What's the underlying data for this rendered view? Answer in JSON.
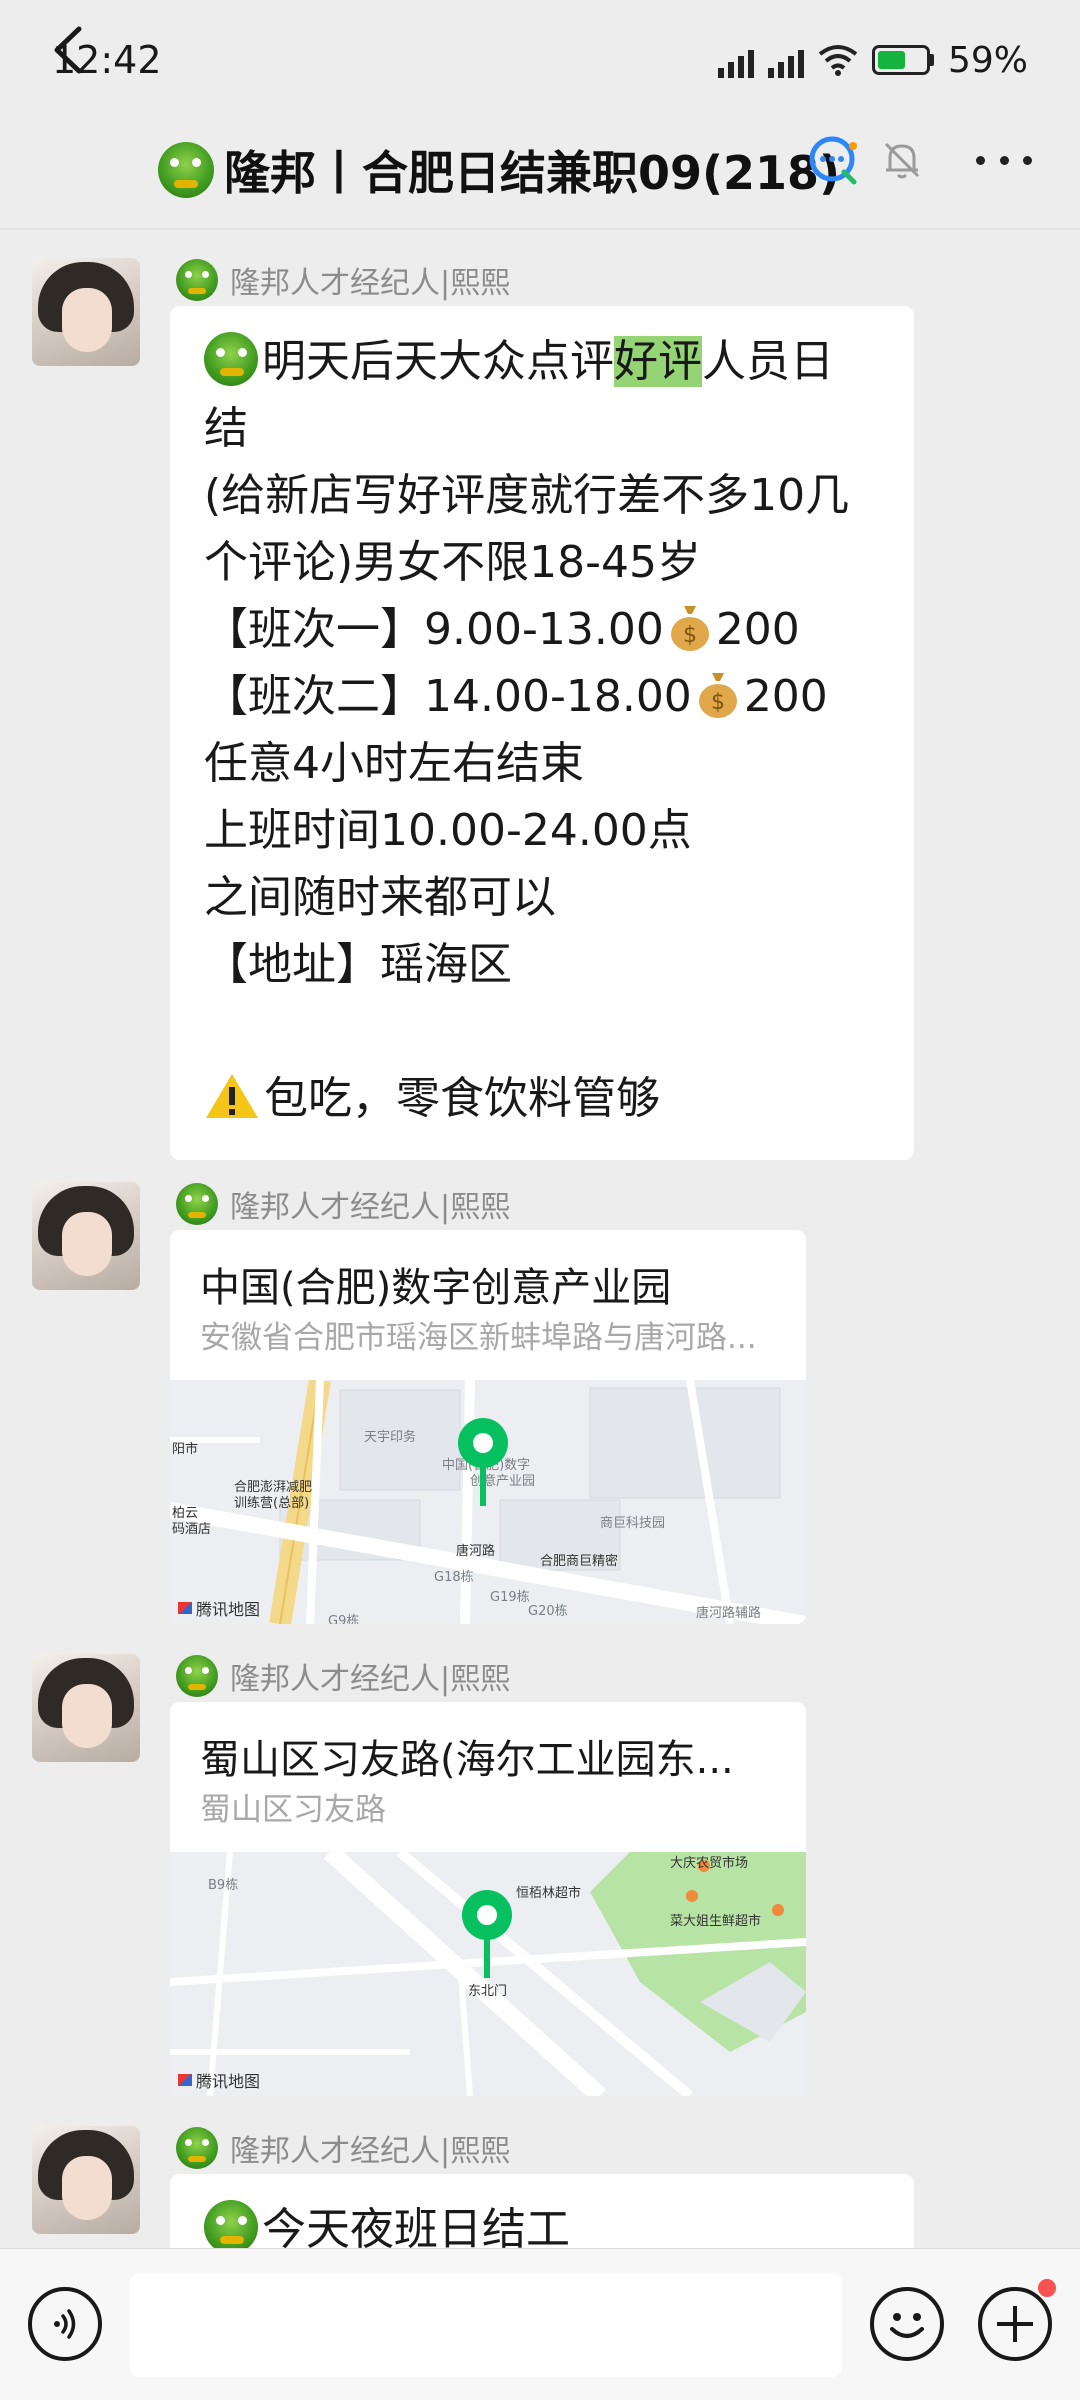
{
  "status_bar": {
    "time": "12:42",
    "battery": "59%"
  },
  "header": {
    "title": "隆邦丨合肥日结兼职09(218)"
  },
  "messages": [
    {
      "sender": "隆邦人才经纪人|熙熙",
      "lines": {
        "l1_pre": "明天后天大众点评",
        "l1_hl": "好评",
        "l1_post": "人员日",
        "l2": "结",
        "l3": "(给新店写好评度就行差不多10几",
        "l4": "个评论)男女不限18-45岁",
        "l5_pre": "【班次一】9.00-13.00",
        "l5_post": "200",
        "l6_pre": "【班次二】14.00-18.00",
        "l6_post": "200",
        "l7": "任意4小时左右结束",
        "l8": "上班时间10.00-24.00点",
        "l9": "之间随时来都可以",
        "l10": "【地址】瑶海区",
        "l11": "包吃，零食饮料管够"
      }
    },
    {
      "sender": "隆邦人才经纪人|熙熙",
      "location_title": "中国(合肥)数字创意产业园",
      "location_address": "安徽省合肥市瑶海区新蚌埠路与唐河路...",
      "map_labels": [
        "天宇印务",
        "合肥澎湃减肥",
        "训练营(总部)",
        "中国(合肥)数字",
        "创意产业园",
        "商巨科技园",
        "唐河路",
        "合肥商巨精密",
        "G18栋",
        "G19栋",
        "G20栋",
        "G9栋",
        "唐河路辅路",
        "阳市",
        "柏云",
        "码酒店"
      ],
      "map_credit": "腾讯地图"
    },
    {
      "sender": "隆邦人才经纪人|熙熙",
      "location_title": "蜀山区习友路(海尔工业园东...",
      "location_address": "蜀山区习友路",
      "map_labels": [
        "B9栋",
        "恒栢林超市",
        "东北门",
        "菜大姐生鲜超市",
        "大庆农贸市场"
      ],
      "map_credit": "腾讯地图"
    },
    {
      "sender": "隆邦人才经纪人|熙熙",
      "text": "今天夜班日结工"
    }
  ],
  "icons": {
    "back": "back-arrow-icon",
    "chat_group": "chat-bubble-icon",
    "mute": "mute-bell-icon",
    "more": "more-dots-icon",
    "voice": "voice-icon",
    "emoji": "emoji-icon",
    "plus": "plus-icon"
  },
  "colors": {
    "highlight": "#95d475",
    "accent": "#07c160",
    "background": "#ededed",
    "badge": "#fa5151"
  }
}
